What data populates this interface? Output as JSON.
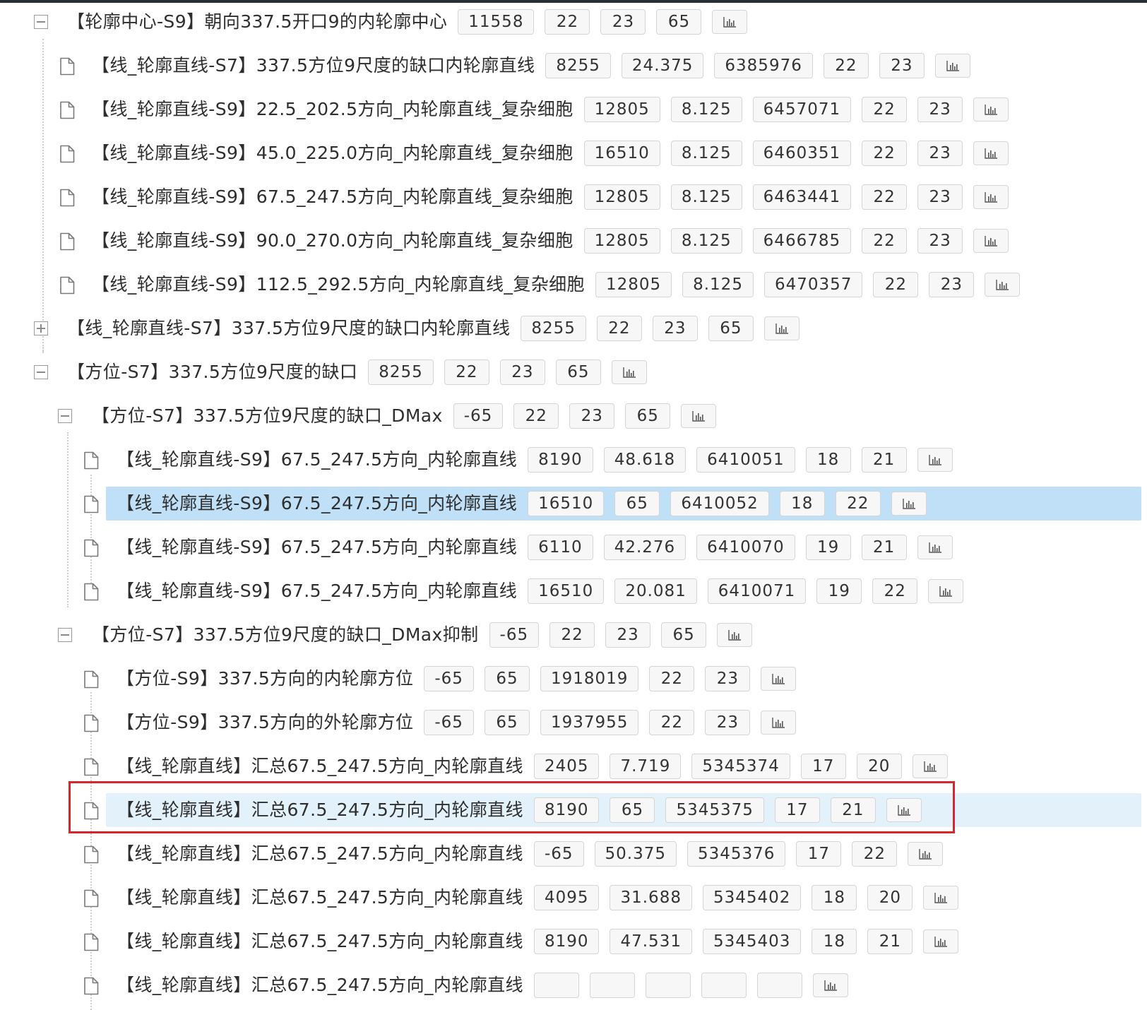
{
  "colors": {
    "selected_strong": "#bfe0f7",
    "selected_light": "#e3f1fb",
    "highlight_box": "#d7262e"
  },
  "tree": {
    "rows": [
      {
        "depth": 0,
        "type": "folder",
        "expanded": true,
        "label": "【轮廓中心-S9】朝向337.5开口9的内轮廓中心",
        "badges": [
          "11558",
          "22",
          "23",
          "65"
        ],
        "icon": "bar-chart-icon"
      },
      {
        "depth": 1,
        "type": "file",
        "label": "【线_轮廓直线-S7】337.5方位9尺度的缺口内轮廓直线",
        "badges": [
          "8255",
          "24.375",
          "6385976",
          "22",
          "23"
        ],
        "icon": "bar-chart-icon"
      },
      {
        "depth": 1,
        "type": "file",
        "label": "【线_轮廓直线-S9】22.5_202.5方向_内轮廓直线_复杂细胞",
        "badges": [
          "12805",
          "8.125",
          "6457071",
          "22",
          "23"
        ],
        "icon": "bar-chart-icon"
      },
      {
        "depth": 1,
        "type": "file",
        "label": "【线_轮廓直线-S9】45.0_225.0方向_内轮廓直线_复杂细胞",
        "badges": [
          "16510",
          "8.125",
          "6460351",
          "22",
          "23"
        ],
        "icon": "bar-chart-icon"
      },
      {
        "depth": 1,
        "type": "file",
        "label": "【线_轮廓直线-S9】67.5_247.5方向_内轮廓直线_复杂细胞",
        "badges": [
          "12805",
          "8.125",
          "6463441",
          "22",
          "23"
        ],
        "icon": "bar-chart-icon"
      },
      {
        "depth": 1,
        "type": "file",
        "label": "【线_轮廓直线-S9】90.0_270.0方向_内轮廓直线_复杂细胞",
        "badges": [
          "12805",
          "8.125",
          "6466785",
          "22",
          "23"
        ],
        "icon": "bar-chart-icon"
      },
      {
        "depth": 1,
        "type": "file",
        "label": "【线_轮廓直线-S9】112.5_292.5方向_内轮廓直线_复杂细胞",
        "badges": [
          "12805",
          "8.125",
          "6470357",
          "22",
          "23"
        ],
        "icon": "bar-chart-icon"
      },
      {
        "depth": 0,
        "type": "folder",
        "expanded": false,
        "label": "【线_轮廓直线-S7】337.5方位9尺度的缺口内轮廓直线",
        "badges": [
          "8255",
          "22",
          "23",
          "65"
        ],
        "icon": "bar-chart-icon"
      },
      {
        "depth": 0,
        "type": "folder",
        "expanded": true,
        "label": "【方位-S7】337.5方位9尺度的缺口",
        "badges": [
          "8255",
          "22",
          "23",
          "65"
        ],
        "icon": "bar-chart-icon"
      },
      {
        "depth": 1,
        "type": "folder",
        "expanded": true,
        "label": "【方位-S7】337.5方位9尺度的缺口_DMax",
        "badges": [
          "-65",
          "22",
          "23",
          "65"
        ],
        "icon": "bar-chart-icon"
      },
      {
        "depth": 2,
        "type": "file",
        "label": "【线_轮廓直线-S9】67.5_247.5方向_内轮廓直线",
        "badges": [
          "8190",
          "48.618",
          "6410051",
          "18",
          "21"
        ],
        "icon": "bar-chart-icon"
      },
      {
        "depth": 2,
        "type": "file",
        "selected": "strong",
        "label": "【线_轮廓直线-S9】67.5_247.5方向_内轮廓直线",
        "badges": [
          "16510",
          "65",
          "6410052",
          "18",
          "22"
        ],
        "icon": "bar-chart-icon"
      },
      {
        "depth": 2,
        "type": "file",
        "label": "【线_轮廓直线-S9】67.5_247.5方向_内轮廓直线",
        "badges": [
          "6110",
          "42.276",
          "6410070",
          "19",
          "21"
        ],
        "icon": "bar-chart-icon"
      },
      {
        "depth": 2,
        "type": "file",
        "label": "【线_轮廓直线-S9】67.5_247.5方向_内轮廓直线",
        "badges": [
          "16510",
          "20.081",
          "6410071",
          "19",
          "22"
        ],
        "icon": "bar-chart-icon"
      },
      {
        "depth": 1,
        "type": "folder",
        "expanded": true,
        "label": "【方位-S7】337.5方位9尺度的缺口_DMax抑制",
        "badges": [
          "-65",
          "22",
          "23",
          "65"
        ],
        "icon": "bar-chart-icon"
      },
      {
        "depth": 2,
        "type": "file",
        "label": "【方位-S9】337.5方向的内轮廓方位",
        "badges": [
          "-65",
          "65",
          "1918019",
          "22",
          "23"
        ],
        "icon": "bar-chart-icon"
      },
      {
        "depth": 2,
        "type": "file",
        "label": "【方位-S9】337.5方向的外轮廓方位",
        "badges": [
          "-65",
          "65",
          "1937955",
          "22",
          "23"
        ],
        "icon": "bar-chart-icon"
      },
      {
        "depth": 2,
        "type": "file",
        "label": "【线_轮廓直线】汇总67.5_247.5方向_内轮廓直线",
        "badges": [
          "2405",
          "7.719",
          "5345374",
          "17",
          "20"
        ],
        "icon": "bar-chart-icon"
      },
      {
        "depth": 2,
        "type": "file",
        "selected": "light",
        "highlighted": true,
        "label": "【线_轮廓直线】汇总67.5_247.5方向_内轮廓直线",
        "badges": [
          "8190",
          "65",
          "5345375",
          "17",
          "21"
        ],
        "icon": "bar-chart-icon"
      },
      {
        "depth": 2,
        "type": "file",
        "label": "【线_轮廓直线】汇总67.5_247.5方向_内轮廓直线",
        "badges": [
          "-65",
          "50.375",
          "5345376",
          "17",
          "22"
        ],
        "icon": "bar-chart-icon"
      },
      {
        "depth": 2,
        "type": "file",
        "label": "【线_轮廓直线】汇总67.5_247.5方向_内轮廓直线",
        "badges": [
          "4095",
          "31.688",
          "5345402",
          "18",
          "20"
        ],
        "icon": "bar-chart-icon"
      },
      {
        "depth": 2,
        "type": "file",
        "label": "【线_轮廓直线】汇总67.5_247.5方向_内轮廓直线",
        "badges": [
          "8190",
          "47.531",
          "5345403",
          "18",
          "21"
        ],
        "icon": "bar-chart-icon"
      },
      {
        "depth": 2,
        "type": "file",
        "label": "【线_轮廓直线】汇总67.5_247.5方向_内轮廓直线",
        "badges": [
          "",
          "",
          "",
          "",
          ""
        ],
        "icon": "bar-chart-icon"
      }
    ]
  }
}
